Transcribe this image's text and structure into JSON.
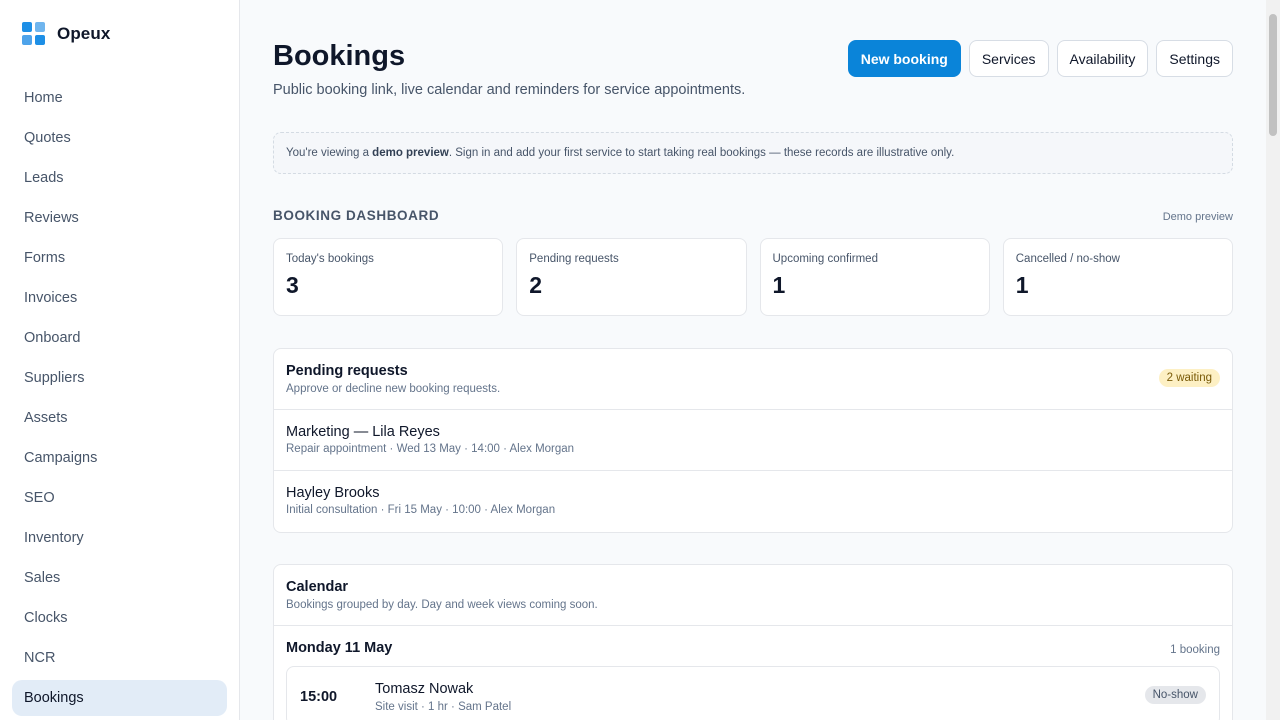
{
  "app": {
    "name": "Opeux"
  },
  "sidebar": {
    "items": [
      {
        "label": "Home"
      },
      {
        "label": "Quotes"
      },
      {
        "label": "Leads"
      },
      {
        "label": "Reviews"
      },
      {
        "label": "Forms"
      },
      {
        "label": "Invoices"
      },
      {
        "label": "Onboard"
      },
      {
        "label": "Suppliers"
      },
      {
        "label": "Assets"
      },
      {
        "label": "Campaigns"
      },
      {
        "label": "SEO"
      },
      {
        "label": "Inventory"
      },
      {
        "label": "Sales"
      },
      {
        "label": "Clocks"
      },
      {
        "label": "NCR"
      },
      {
        "label": "Bookings",
        "active": true
      }
    ]
  },
  "header": {
    "title": "Bookings",
    "subtitle": "Public booking link, live calendar and reminders for service appointments.",
    "actions": {
      "new_booking": "New booking",
      "services": "Services",
      "availability": "Availability",
      "settings": "Settings"
    }
  },
  "notice": {
    "prefix": "You're viewing a ",
    "highlight": "demo preview",
    "suffix": ". Sign in and add your first service to start taking real bookings — these records are illustrative only."
  },
  "dashboard": {
    "title": "BOOKING DASHBOARD",
    "meta": "Demo preview",
    "stats": [
      {
        "label": "Today's bookings",
        "value": "3"
      },
      {
        "label": "Pending requests",
        "value": "2"
      },
      {
        "label": "Upcoming confirmed",
        "value": "1"
      },
      {
        "label": "Cancelled / no-show",
        "value": "1"
      }
    ]
  },
  "pending": {
    "title": "Pending requests",
    "subtitle": "Approve or decline new booking requests.",
    "badge": "2 waiting",
    "requests": [
      {
        "name": "Marketing — Lila Reyes",
        "meta": "Repair appointment · Wed 13 May · 14:00 · Alex Morgan"
      },
      {
        "name": "Hayley Brooks",
        "meta": "Initial consultation · Fri 15 May · 10:00 · Alex Morgan"
      }
    ]
  },
  "calendar": {
    "title": "Calendar",
    "subtitle": "Bookings grouped by day. Day and week views coming soon.",
    "day": {
      "title": "Monday 11 May",
      "count": "1 booking",
      "bookings": [
        {
          "time": "15:00",
          "name": "Tomasz Nowak",
          "meta": "Site visit · 1 hr · Sam Patel",
          "status": "No-show"
        }
      ]
    }
  },
  "colors": {
    "accent": "#0a84d9",
    "active_nav": "#e2ecf7",
    "waiting_badge": "#fdf0c4",
    "noshow_badge": "#e5e7eb"
  }
}
